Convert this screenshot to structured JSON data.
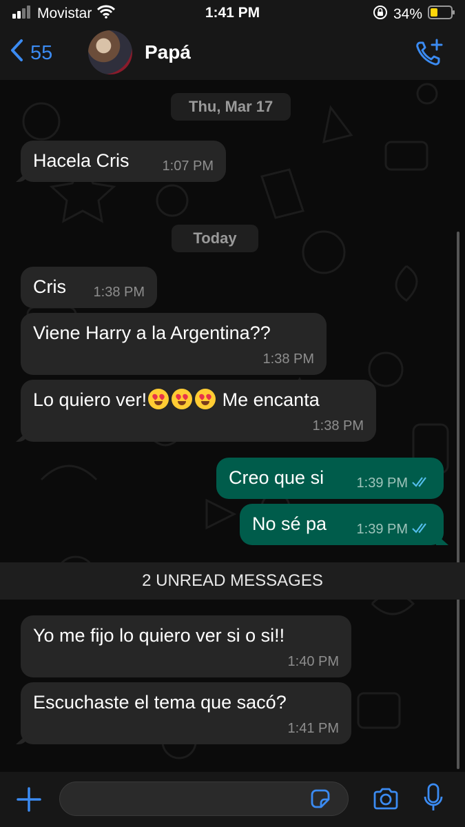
{
  "status_bar": {
    "carrier": "Movistar",
    "time": "1:41 PM",
    "battery": "34%"
  },
  "header": {
    "back_count": "55",
    "contact_name": "Papá"
  },
  "chat": {
    "date_separators": [
      "Thu, Mar 17",
      "Today"
    ],
    "unread_banner": "2 UNREAD MESSAGES",
    "messages": [
      {
        "text": "Hacela Cris",
        "time": "1:07 PM",
        "direction": "incoming"
      },
      {
        "text": "Cris",
        "time": "1:38 PM",
        "direction": "incoming"
      },
      {
        "text": "Viene Harry a la Argentina??",
        "time": "1:38 PM",
        "direction": "incoming"
      },
      {
        "text_before": "Lo quiero ver!",
        "text_after": "Me encanta",
        "emoji": "heart-eyes-emoji",
        "emoji_count": 3,
        "time": "1:38 PM",
        "direction": "incoming"
      },
      {
        "text": "Creo que si",
        "time": "1:39 PM",
        "direction": "outgoing",
        "status": "read"
      },
      {
        "text": "No sé pa",
        "time": "1:39 PM",
        "direction": "outgoing",
        "status": "read"
      },
      {
        "text": "Yo me fijo lo quiero ver si o si!!",
        "time": "1:40 PM",
        "direction": "incoming"
      },
      {
        "text": "Escuchaste el tema que sacó?",
        "time": "1:41 PM",
        "direction": "incoming"
      }
    ]
  },
  "input_bar": {
    "placeholder": ""
  },
  "icons": {
    "signal": "signal-icon",
    "wifi": "wifi-icon",
    "lock": "rotation-lock-icon",
    "battery": "battery-icon",
    "back": "chevron-left-icon",
    "call": "add-call-icon",
    "plus": "plus-icon",
    "sticker": "sticker-icon",
    "camera": "camera-icon",
    "mic": "microphone-icon",
    "ticks": "double-check-icon"
  },
  "colors": {
    "accent": "#3b8bf2",
    "incoming_bubble": "#262626",
    "outgoing_bubble": "#005c4b",
    "background": "#0b0b0b",
    "read_ticks": "#53bdeb",
    "battery": "#ffd60a"
  }
}
